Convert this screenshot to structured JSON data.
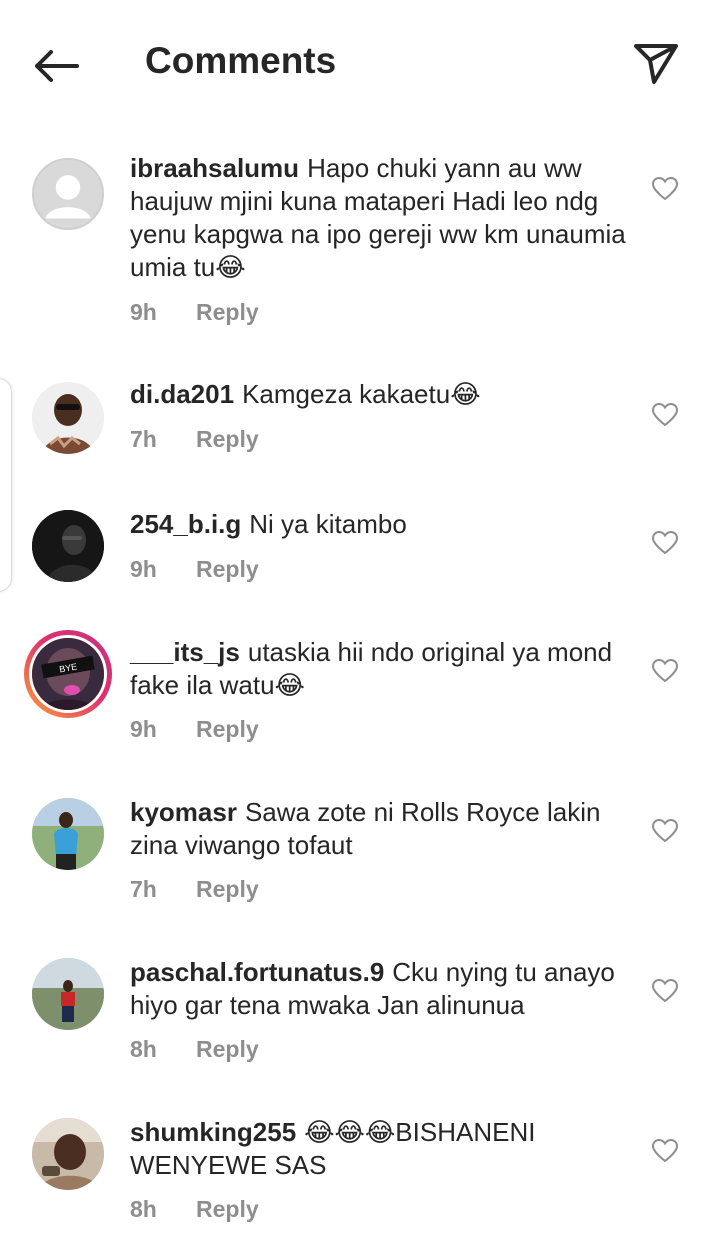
{
  "header": {
    "title": "Comments",
    "back_icon": "arrow-left-icon",
    "share_icon": "paper-plane-icon"
  },
  "reply_label": "Reply",
  "colors": {
    "text": "#262626",
    "meta": "#8e8e8e",
    "story_ring_start": "#f9a33b",
    "story_ring_end": "#c13584"
  },
  "comments": [
    {
      "username": "ibraahsalumu",
      "text": "Hapo chuki yann au ww haujuw mjini kuna mataperi Hadi leo ndg yenu kapgwa na ipo gereji ww km unaumia umia tu😂",
      "time": "9h"
    },
    {
      "username": "di.da201",
      "text": "Kamgeza kakaetu😂",
      "time": "7h"
    },
    {
      "username": "254_b.i.g",
      "text": "Ni ya kitambo",
      "time": "9h"
    },
    {
      "username": "___its_js",
      "text": "utaskia hii ndo original ya mond fake ila watu😂",
      "time": "9h",
      "avatar_caption": "BYE"
    },
    {
      "username": "kyomasr",
      "text": "Sawa zote ni Rolls Royce lakin zina viwango tofaut",
      "time": "7h"
    },
    {
      "username": "paschal.fortunatus.9",
      "text": "Cku nying tu anayo hiyo gar tena mwaka Jan alinunua",
      "time": "8h"
    },
    {
      "username": "shumking255",
      "text": "😂😂😂BISHANENI WENYEWE SAS",
      "time": "8h"
    }
  ]
}
